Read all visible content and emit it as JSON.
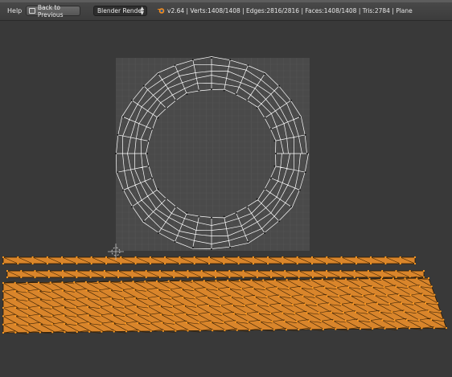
{
  "header": {
    "help_menu": "Help",
    "back_button": "Back to Previous",
    "render_engine": "Blender Render",
    "stats": "v2.64 | Verts:1408/1408 | Edges:2816/2816 | Faces:1408/1408 | Tris:2784 | Plane"
  },
  "icons": {
    "back": "screen-back-icon",
    "dropdown": "updown-arrows-icon",
    "logo": "blender-logo-icon",
    "cursor": "2d-cursor-icon"
  },
  "colors": {
    "background": "#393939",
    "image_bg": "#4a4a4a",
    "wire": "#ffffff",
    "selected_face": "#d9852b",
    "vertex": "#ff9a1e"
  }
}
